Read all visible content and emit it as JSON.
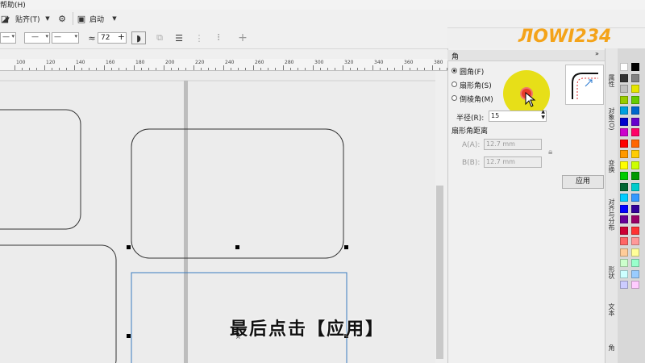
{
  "menubar": {
    "help": "帮助(H)"
  },
  "toolbar1": {
    "snap_label": "贴齐(T)",
    "launch_label": "启动"
  },
  "toolbar2": {
    "angle_value": "72"
  },
  "ruler": {
    "labels": [
      "100",
      "120",
      "140",
      "160",
      "180",
      "200",
      "220",
      "240",
      "260",
      "280",
      "300",
      "320",
      "340",
      "360",
      "380"
    ]
  },
  "docker": {
    "title": "角",
    "options": [
      {
        "label": "圆角(F)",
        "selected": true
      },
      {
        "label": "扇形角(S)",
        "selected": false
      },
      {
        "label": "倒棱角(M)",
        "selected": false
      }
    ],
    "radius_label": "半径(R):",
    "radius_value": "15",
    "distance_label": "扇形角距离",
    "a_label": "A(A):",
    "a_value": "12.7 mm",
    "b_label": "B(B):",
    "b_value": "12.7 mm",
    "apply_label": "应用"
  },
  "sidetabs": [
    "属性",
    "对象(O)",
    "变换",
    "对齐与分布",
    "形状",
    "文本",
    "角"
  ],
  "palette_colors": [
    "#ffffff",
    "#000000",
    "#333333",
    "#808080",
    "#c0c0c0",
    "#e6e600",
    "#99cc00",
    "#66cc00",
    "#00a0e0",
    "#0066cc",
    "#0000cc",
    "#6600cc",
    "#cc00cc",
    "#ff0066",
    "#ff0000",
    "#ff6600",
    "#ff9900",
    "#ffcc00",
    "#ffff00",
    "#ccff00",
    "#00cc00",
    "#009900",
    "#006633",
    "#00cccc",
    "#00ccff",
    "#3399ff",
    "#0000ff",
    "#330099",
    "#660099",
    "#990066",
    "#cc0033",
    "#ff3333",
    "#ff6666",
    "#ff9999",
    "#ffcc99",
    "#ffff99",
    "#ccffcc",
    "#99ffcc",
    "#ccffff",
    "#99ccff",
    "#ccccff",
    "#ffccff"
  ],
  "caption": "最后点击【应用】",
  "logo": "ЛOWI234"
}
